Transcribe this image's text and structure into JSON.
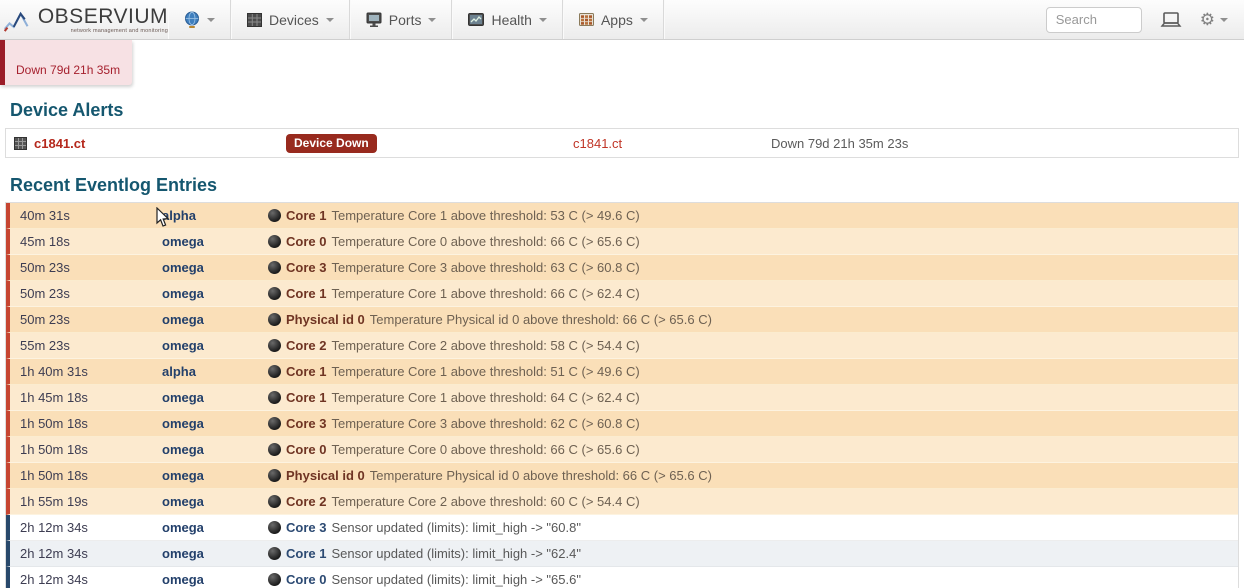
{
  "navbar": {
    "logo": {
      "title": "OBSERVIUM",
      "subtitle": "network management and monitoring"
    },
    "menus": [
      {
        "label": "Devices"
      },
      {
        "label": "Ports"
      },
      {
        "label": "Health"
      },
      {
        "label": "Apps"
      }
    ],
    "search_placeholder": "Search"
  },
  "status_widget": {
    "down_label": "Down 79d 21h 35m"
  },
  "device_alerts": {
    "heading": "Device Alerts",
    "rows": [
      {
        "device": "c1841.ct",
        "alert": "Device Down",
        "entity": "c1841.ct",
        "duration": "Down 79d 21h 35m 23s"
      }
    ]
  },
  "eventlog": {
    "heading": "Recent Eventlog Entries",
    "rows": [
      {
        "time": "40m 31s",
        "device": "alpha",
        "entity": "Core 1",
        "message": "Temperature Core 1 above threshold: 53 C (> 49.6 C)",
        "severity": "warn"
      },
      {
        "time": "45m 18s",
        "device": "omega",
        "entity": "Core 0",
        "message": "Temperature Core 0 above threshold: 66 C (> 65.6 C)",
        "severity": "warn"
      },
      {
        "time": "50m 23s",
        "device": "omega",
        "entity": "Core 3",
        "message": "Temperature Core 3 above threshold: 63 C (> 60.8 C)",
        "severity": "warn"
      },
      {
        "time": "50m 23s",
        "device": "omega",
        "entity": "Core 1",
        "message": "Temperature Core 1 above threshold: 66 C (> 62.4 C)",
        "severity": "warn"
      },
      {
        "time": "50m 23s",
        "device": "omega",
        "entity": "Physical id 0",
        "message": "Temperature Physical id 0 above threshold: 66 C (> 65.6 C)",
        "severity": "warn"
      },
      {
        "time": "55m 23s",
        "device": "omega",
        "entity": "Core 2",
        "message": "Temperature Core 2 above threshold: 58 C (> 54.4 C)",
        "severity": "warn"
      },
      {
        "time": "1h 40m 31s",
        "device": "alpha",
        "entity": "Core 1",
        "message": "Temperature Core 1 above threshold: 51 C (> 49.6 C)",
        "severity": "warn"
      },
      {
        "time": "1h 45m 18s",
        "device": "omega",
        "entity": "Core 1",
        "message": "Temperature Core 1 above threshold: 64 C (> 62.4 C)",
        "severity": "warn"
      },
      {
        "time": "1h 50m 18s",
        "device": "omega",
        "entity": "Core 3",
        "message": "Temperature Core 3 above threshold: 62 C (> 60.8 C)",
        "severity": "warn"
      },
      {
        "time": "1h 50m 18s",
        "device": "omega",
        "entity": "Core 0",
        "message": "Temperature Core 0 above threshold: 66 C (> 65.6 C)",
        "severity": "warn"
      },
      {
        "time": "1h 50m 18s",
        "device": "omega",
        "entity": "Physical id 0",
        "message": "Temperature Physical id 0 above threshold: 66 C (> 65.6 C)",
        "severity": "warn"
      },
      {
        "time": "1h 55m 19s",
        "device": "omega",
        "entity": "Core 2",
        "message": "Temperature Core 2 above threshold: 60 C (> 54.4 C)",
        "severity": "warn"
      },
      {
        "time": "2h 12m 34s",
        "device": "omega",
        "entity": "Core 3",
        "message": "Sensor updated (limits): limit_high -> \"60.8\"",
        "severity": "info"
      },
      {
        "time": "2h 12m 34s",
        "device": "omega",
        "entity": "Core 1",
        "message": "Sensor updated (limits): limit_high -> \"62.4\"",
        "severity": "info"
      },
      {
        "time": "2h 12m 34s",
        "device": "omega",
        "entity": "Core 0",
        "message": "Sensor updated (limits): limit_high -> \"65.6\"",
        "severity": "info"
      }
    ]
  },
  "colors": {
    "heading_teal": "#15576f",
    "warn_border": "#c64531",
    "warn_bg_a": "#fadfb8",
    "warn_bg_b": "#fceacf",
    "info_border": "#28486b",
    "badge_danger_bg": "#982a1e",
    "device_link_red": "#b5281c",
    "device_link_blue": "#23406b"
  }
}
